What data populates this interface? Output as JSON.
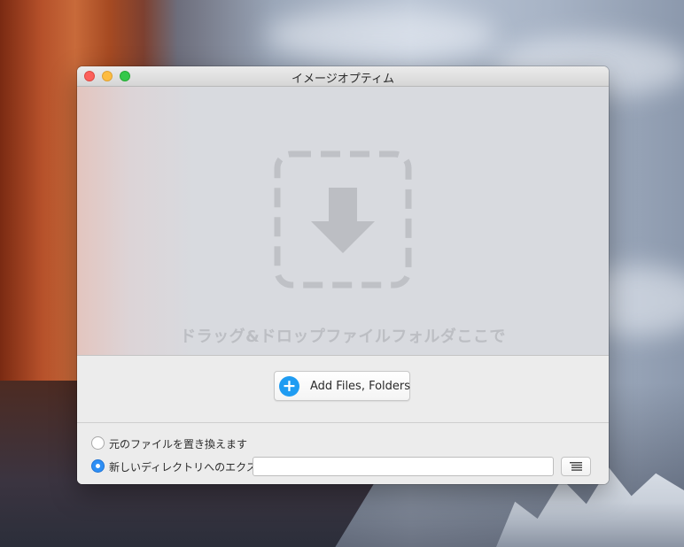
{
  "window": {
    "title": "イメージオプティム"
  },
  "drop_zone": {
    "icon": "drop-download-arrow-icon",
    "text": "ドラッグ&ドロップファイルフォルダここで"
  },
  "add_button": {
    "icon": "plus-icon",
    "plus_glyph": "+",
    "label": "Add Files, Folders"
  },
  "options": {
    "replace_label": "元のファイルを置き換えます",
    "replace_selected": false,
    "export_label": "新しいディレクトリへのエクスポート",
    "export_selected": true,
    "export_path_value": "",
    "browse_icon": "list-icon"
  },
  "colors": {
    "accent": "#1f9cf2",
    "radio_selected": "#2e8ff5",
    "close": "#fc605b",
    "minimize": "#fdbc40",
    "zoom": "#34c84a"
  }
}
